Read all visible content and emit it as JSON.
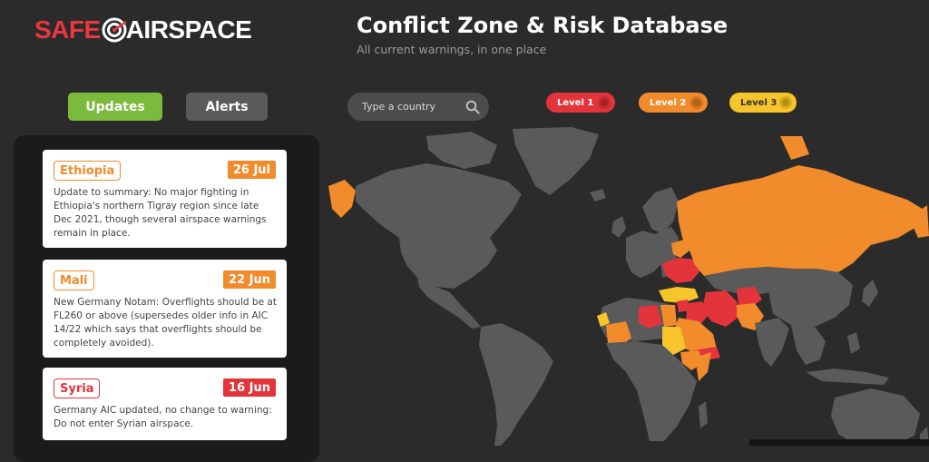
{
  "logo": {
    "text_left": "SAFE",
    "text_right": "AIRSPACE"
  },
  "header": {
    "title": "Conflict Zone & Risk Database",
    "subtitle": "All current warnings, in one place"
  },
  "tabs": {
    "updates": "Updates",
    "alerts": "Alerts"
  },
  "search": {
    "placeholder": "Type a country",
    "icon": "search-icon"
  },
  "levels": [
    {
      "label": "Level 1",
      "color": "#e3343b"
    },
    {
      "label": "Level 2",
      "color": "#f18b2b"
    },
    {
      "label": "Level 3",
      "color": "#f7c42b"
    }
  ],
  "updates": [
    {
      "country": "Ethiopia",
      "date": "26 Jul",
      "level_color": "#f18b2b",
      "text": "Update to summary: No major fighting in Ethiopia's northern Tigray region since late Dec 2021, though several airspace warnings remain in place."
    },
    {
      "country": "Mali",
      "date": "22 Jun",
      "level_color": "#f18b2b",
      "text": "New Germany Notam: Overflights should be at FL260 or above (supersedes older info in AIC 14/22 which says that overflights should be completely avoided)."
    },
    {
      "country": "Syria",
      "date": "16 Jun",
      "level_color": "#e3343b",
      "text": "Germany AIC updated, no change to warning: Do not enter Syrian airspace."
    }
  ],
  "map": {
    "land_color": "#5a5a5a",
    "ocean_color": "#2b2b2b",
    "highlighted": [
      {
        "country": "Russia",
        "level": 2
      },
      {
        "country": "Ukraine",
        "level": 1
      },
      {
        "country": "Belarus",
        "level": 2
      },
      {
        "country": "Turkey",
        "level": 3
      },
      {
        "country": "Syria",
        "level": 1
      },
      {
        "country": "Iraq",
        "level": 1
      },
      {
        "country": "Iran",
        "level": 1
      },
      {
        "country": "Afghanistan",
        "level": 1
      },
      {
        "country": "Pakistan",
        "level": 2
      },
      {
        "country": "Libya",
        "level": 1
      },
      {
        "country": "Egypt",
        "level": 2
      },
      {
        "country": "Saudi Arabia",
        "level": 2
      },
      {
        "country": "Yemen",
        "level": 1
      },
      {
        "country": "Sudan",
        "level": 3
      },
      {
        "country": "Ethiopia",
        "level": 2
      },
      {
        "country": "Somalia",
        "level": 2
      },
      {
        "country": "Mali",
        "level": 2
      },
      {
        "country": "Western Sahara",
        "level": 3
      },
      {
        "country": "Alaska",
        "level": 2
      }
    ]
  }
}
